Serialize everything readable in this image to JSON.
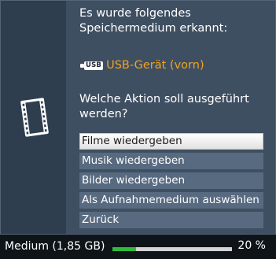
{
  "dialog": {
    "message_line1": "Es wurde folgendes",
    "message_line2": "Speichermedium erkannt:",
    "device_badge": "USB",
    "device_name": "USB-Gerät (vorn)",
    "question_line1": "Welche Aktion soll ausgeführt",
    "question_line2": "werden?",
    "options": [
      {
        "label": "Filme wiedergeben",
        "selected": true
      },
      {
        "label": "Musik wiedergeben",
        "selected": false
      },
      {
        "label": "Bilder wiedergeben",
        "selected": false
      },
      {
        "label": "Als Aufnahmemedium auswählen",
        "selected": false
      },
      {
        "label": "Zurück",
        "selected": false
      }
    ],
    "icon": "film-strip-icon"
  },
  "status": {
    "label": "Medium (1,85 GB)",
    "percent_text": "20 %",
    "progress_fraction": 0.2
  },
  "colors": {
    "accent_orange": "#f0a322",
    "progress_green": "#2dbd3a",
    "dialog_bg": "#3f4f62",
    "option_bg": "#586a80"
  }
}
